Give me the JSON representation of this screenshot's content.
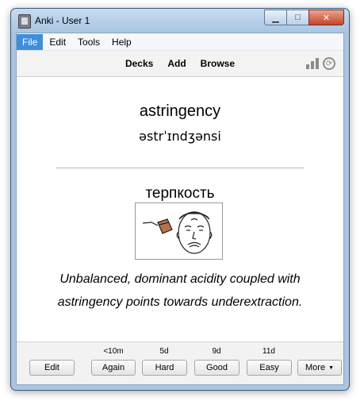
{
  "window": {
    "title": "Anki - User 1",
    "caption": {
      "minimize": "▁",
      "maximize": "□",
      "close": "✕"
    }
  },
  "menu": [
    "File",
    "Edit",
    "Tools",
    "Help"
  ],
  "toolbar": {
    "links": [
      "Decks",
      "Add",
      "Browse"
    ],
    "icons": [
      "stats-icon",
      "sync-icon"
    ]
  },
  "card": {
    "word": "astringency",
    "ipa": "əstrˈɪndʒənsi",
    "translation": "терпкость",
    "image": "cartoon-sour-face",
    "sentence": "Unbalanced, dominant acidity coupled with astringency points towards underextraction."
  },
  "answer": {
    "intervals": {
      "again": "<10m",
      "hard": "5d",
      "good": "9d",
      "easy": "11d"
    },
    "buttons": {
      "edit": "Edit",
      "again": "Again",
      "hard": "Hard",
      "good": "Good",
      "easy": "Easy",
      "more": "More"
    }
  },
  "colors": {
    "menu_active": "#3e8ede",
    "window_frame": "#a9c5e2",
    "close_button": "#c5452a"
  }
}
